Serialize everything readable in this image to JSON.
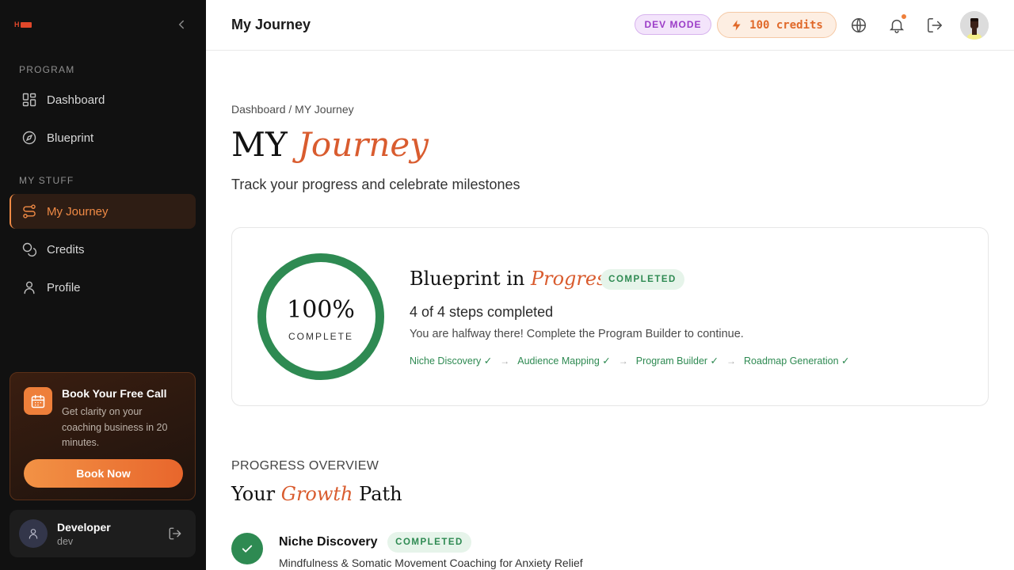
{
  "app": {
    "logo_text": "H"
  },
  "sidebar": {
    "section_program": "PROGRAM",
    "section_mystuff": "MY STUFF",
    "items": [
      {
        "label": "Dashboard",
        "icon": "dashboard-icon"
      },
      {
        "label": "Blueprint",
        "icon": "compass-icon"
      },
      {
        "label": "My Journey",
        "icon": "route-icon",
        "active": true
      },
      {
        "label": "Credits",
        "icon": "coins-icon"
      },
      {
        "label": "Profile",
        "icon": "user-icon"
      }
    ],
    "promo": {
      "title": "Book Your Free Call",
      "text": "Get clarity on your coaching business in 20 minutes.",
      "button": "Book Now"
    },
    "user": {
      "name": "Developer",
      "role": "dev"
    }
  },
  "header": {
    "title": "My Journey",
    "dev_badge": "DEV MODE",
    "credits": "100 credits"
  },
  "main": {
    "breadcrumb": "Dashboard / MY Journey",
    "hero_plain": "MY ",
    "hero_accent": "Journey",
    "subtitle": "Track your progress and celebrate milestones",
    "card": {
      "percent": "100%",
      "percent_value": 1.0,
      "percent_label": "COMPLETE",
      "title_plain": "Blueprint in ",
      "title_accent": "Progress",
      "status": "COMPLETED",
      "steps_count": "4 of 4 steps completed",
      "steps_desc": "You are halfway there! Complete the Program Builder to continue.",
      "steps": [
        "Niche Discovery ✓",
        "Audience Mapping ✓",
        "Program Builder ✓",
        "Roadmap Generation ✓"
      ]
    },
    "overview_label": "PROGRESS OVERVIEW",
    "growth_plain_1": "Your ",
    "growth_accent": "Growth",
    "growth_plain_2": " Path",
    "timeline": [
      {
        "title": "Niche Discovery",
        "status": "COMPLETED",
        "desc": "Mindfulness & Somatic Movement Coaching for Anxiety Relief"
      }
    ]
  },
  "colors": {
    "accent": "#d95c2f",
    "success": "#2e8a52",
    "sidebar_bg": "#111111"
  }
}
